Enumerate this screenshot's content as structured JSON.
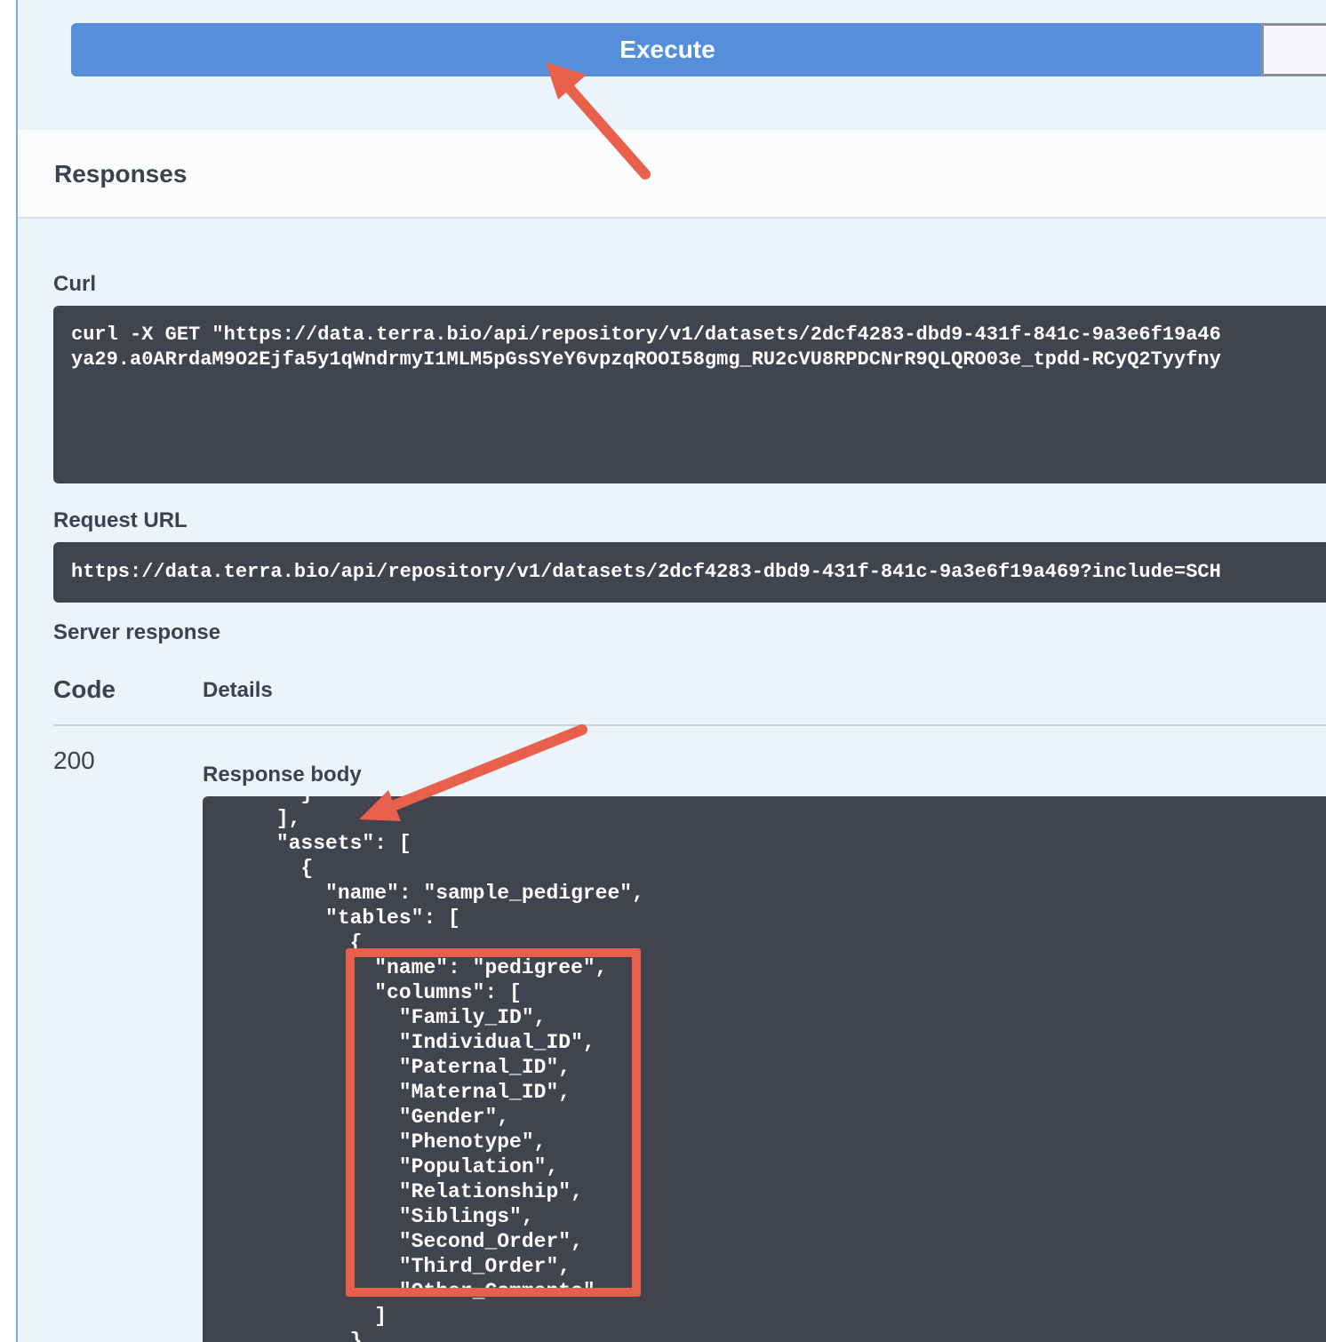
{
  "execute": {
    "label": "Execute"
  },
  "responses": {
    "title": "Responses"
  },
  "curl": {
    "label": "Curl",
    "lines": [
      "curl -X GET \"https://data.terra.bio/api/repository/v1/datasets/2dcf4283-dbd9-431f-841c-9a3e6f19a46",
      "ya29.a0ARrdaM9O2Ejfa5y1qWndrmyI1MLM5pGsSYeY6vpzqROOI58gmg_RU2cVU8RPDCNrR9QLQRO03e_tpdd-RCyQ2Tyyfny"
    ]
  },
  "request_url": {
    "label": "Request URL",
    "value": "https://data.terra.bio/api/repository/v1/datasets/2dcf4283-dbd9-431f-841c-9a3e6f19a469?include=SCH"
  },
  "server_response": {
    "label": "Server response",
    "code_heading": "Code",
    "details_heading": "Details",
    "status_code": "200",
    "body_label": "Response body",
    "body_lines": [
      "        }",
      "      ],",
      "      \"assets\": [",
      "        {",
      "          \"name\": \"sample_pedigree\",",
      "          \"tables\": [",
      "            {",
      "              \"name\": \"pedigree\",",
      "              \"columns\": [",
      "                \"Family_ID\",",
      "                \"Individual_ID\",",
      "                \"Paternal_ID\",",
      "                \"Maternal_ID\",",
      "                \"Gender\",",
      "                \"Phenotype\",",
      "                \"Population\",",
      "                \"Relationship\",",
      "                \"Siblings\",",
      "                \"Second_Order\",",
      "                \"Third_Order\",",
      "                \"Other_Comments\"",
      "              ]",
      "            }"
    ]
  },
  "annotations": {
    "arrow_color": "#e8604c",
    "box_color": "#e8604c"
  },
  "colors": {
    "execute_button": "#558fdb",
    "code_background": "#41444e",
    "panel_background": "#ebf3fb",
    "text": "#3b4151"
  }
}
